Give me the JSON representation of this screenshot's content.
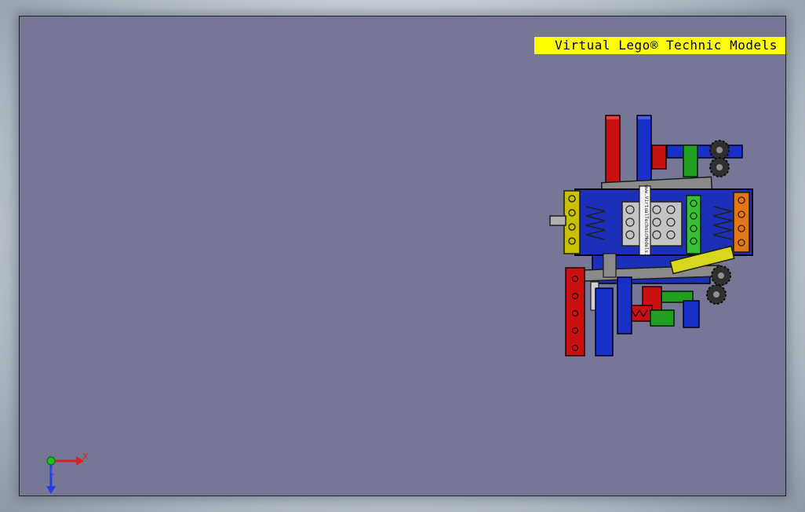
{
  "watermark": {
    "text": "Virtual Lego® Technic Models"
  },
  "model": {
    "sticker_text": "www.VirtualTechnicModels.com"
  },
  "triad": {
    "x_label": "X"
  },
  "colors": {
    "viewport_background": "#767696",
    "banner_background": "#ffff00",
    "banner_text": "#000040",
    "axis_x": "#e02020",
    "axis_y": "#20c020",
    "axis_z": "#2040e0"
  }
}
